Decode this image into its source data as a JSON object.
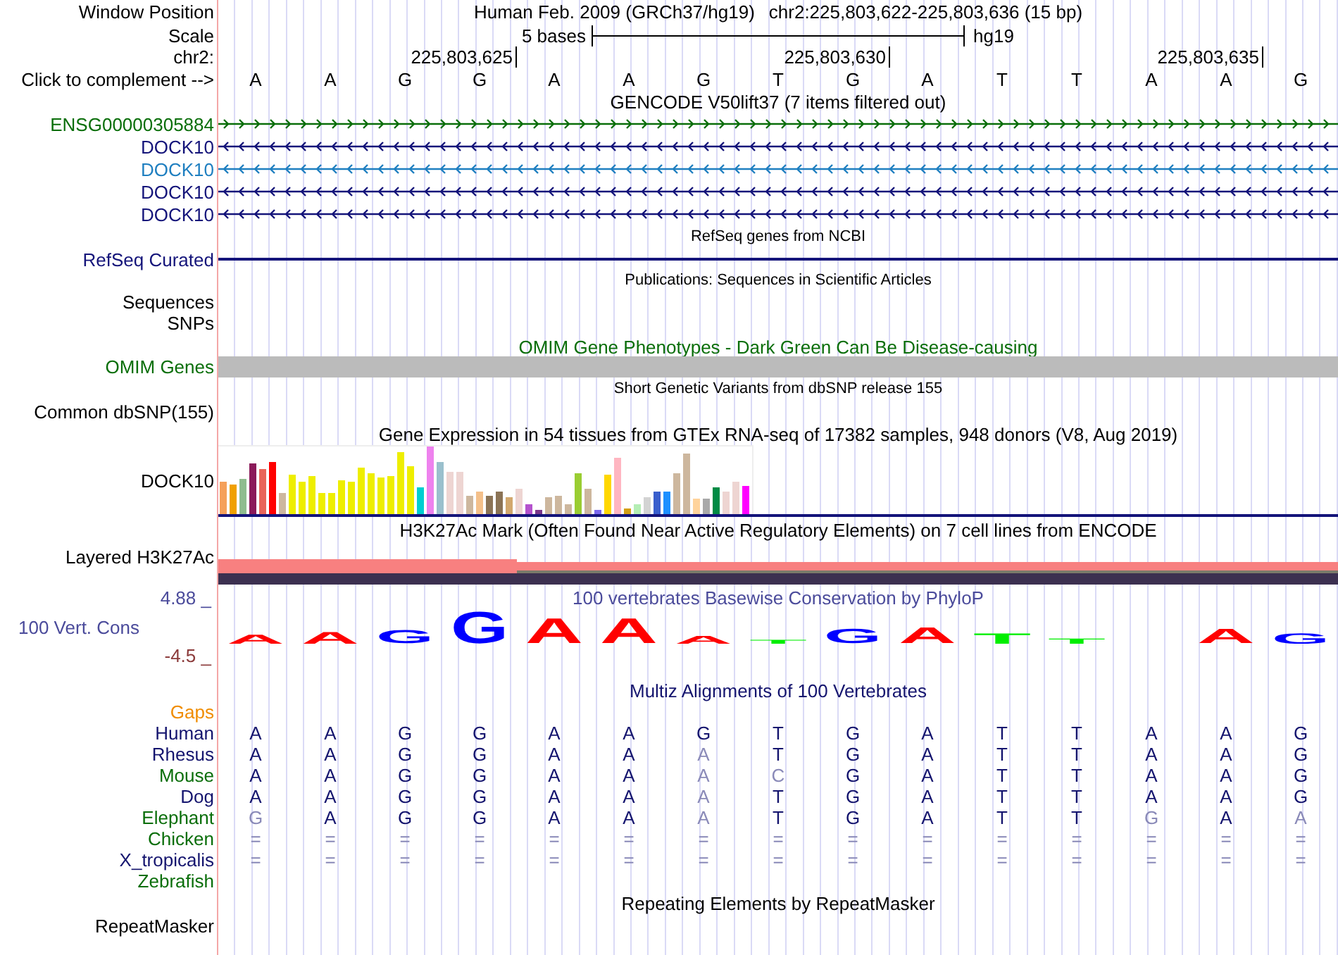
{
  "header": {
    "window_label": "Window Position",
    "assembly": "Human Feb. 2009 (GRCh37/hg19)",
    "position": "chr2:225,803,622-225,803,636 (15 bp)",
    "scale_label": "Scale",
    "scale_text": "5 bases",
    "scale_assembly": "hg19",
    "chrom_label": "chr2:",
    "ticks": [
      "225,803,625",
      "225,803,630",
      "225,803,635"
    ],
    "complement_label": "Click to complement -->",
    "bases": [
      "A",
      "A",
      "G",
      "G",
      "A",
      "A",
      "G",
      "T",
      "G",
      "A",
      "T",
      "T",
      "A",
      "A",
      "G"
    ]
  },
  "gencode": {
    "title": "GENCODE V50lift37 (7 items filtered out)",
    "genes": [
      {
        "name": "ENSG00000305884",
        "color": "#0a6e0a",
        "kind": "forward"
      },
      {
        "name": "DOCK10",
        "color": "#14147a",
        "kind": "reverse"
      },
      {
        "name": "DOCK10",
        "color": "#1f7fc0",
        "kind": "reverse"
      },
      {
        "name": "DOCK10",
        "color": "#14147a",
        "kind": "reverse"
      },
      {
        "name": "DOCK10",
        "color": "#14147a",
        "kind": "reverse"
      }
    ]
  },
  "refseq": {
    "title": "RefSeq genes from NCBI",
    "label": "RefSeq Curated"
  },
  "publications": {
    "title": "Publications: Sequences in Scientific Articles",
    "labels": [
      "Sequences",
      "SNPs"
    ]
  },
  "omim": {
    "title": "OMIM Gene Phenotypes - Dark Green Can Be Disease-causing",
    "label": "OMIM Genes"
  },
  "dbsnp": {
    "title": "Short Genetic Variants from dbSNP release 155",
    "label": "Common dbSNP(155)"
  },
  "gtex": {
    "title": "Gene Expression in 54 tissues from GTEx RNA-seq of 17382 samples, 948 donors (V8, Aug 2019)",
    "label": "DOCK10"
  },
  "h3k27ac": {
    "title": "H3K27Ac Mark (Often Found Near Active Regulatory Elements) on 7 cell lines from ENCODE",
    "label": "Layered H3K27Ac"
  },
  "phylop": {
    "title": "100 vertebrates Basewise Conservation by PhyloP",
    "max": "4.88 _",
    "label": "100 Vert. Cons",
    "min": "-4.5 _",
    "logo": [
      {
        "base": "A"
      },
      {
        "base": "A"
      },
      {
        "base": "G"
      },
      {
        "base": "G"
      },
      {
        "base": "A"
      },
      {
        "base": "A"
      },
      {
        "base": "A"
      },
      {
        "base": "T"
      },
      {
        "base": "G"
      },
      {
        "base": "A"
      },
      {
        "base": "T"
      },
      {
        "base": "T"
      },
      {
        "base": "A"
      },
      {
        "base": "G"
      }
    ]
  },
  "multiz": {
    "title": "Multiz Alignments of 100 Vertebrates",
    "gaps_label": "Gaps",
    "species": [
      {
        "name": "Human",
        "color": "#14146e",
        "bases": [
          "A",
          "A",
          "G",
          "G",
          "A",
          "A",
          "G",
          "T",
          "G",
          "A",
          "T",
          "T",
          "A",
          "A",
          "G"
        ]
      },
      {
        "name": "Rhesus",
        "color": "#14146e",
        "bases": [
          "A",
          "A",
          "G",
          "G",
          "A",
          "A",
          "A",
          "T",
          "G",
          "A",
          "T",
          "T",
          "A",
          "A",
          "G"
        ]
      },
      {
        "name": "Mouse",
        "color": "#0a6e0a",
        "bases": [
          "A",
          "A",
          "G",
          "G",
          "A",
          "A",
          "A",
          "C",
          "G",
          "A",
          "T",
          "T",
          "A",
          "A",
          "G"
        ]
      },
      {
        "name": "Dog",
        "color": "#14146e",
        "bases": [
          "A",
          "A",
          "G",
          "G",
          "A",
          "A",
          "A",
          "T",
          "G",
          "A",
          "T",
          "T",
          "A",
          "A",
          "G"
        ]
      },
      {
        "name": "Elephant",
        "color": "#0a6e0a",
        "bases": [
          "G",
          "A",
          "G",
          "G",
          "A",
          "A",
          "A",
          "T",
          "G",
          "A",
          "T",
          "T",
          "G",
          "A",
          "A"
        ]
      },
      {
        "name": "Chicken",
        "color": "#0a6e0a",
        "bases": [
          "=",
          "=",
          "=",
          "=",
          "=",
          "=",
          "=",
          "=",
          "=",
          "=",
          "=",
          "=",
          "=",
          "=",
          "="
        ]
      },
      {
        "name": "X_tropicalis",
        "color": "#14146e",
        "bases": [
          "=",
          "=",
          "=",
          "=",
          "=",
          "=",
          "=",
          "=",
          "=",
          "=",
          "=",
          "=",
          "=",
          "=",
          "="
        ]
      },
      {
        "name": "Zebrafish",
        "color": "#0a6e0a"
      }
    ]
  },
  "repeatmasker": {
    "title": "Repeating Elements by RepeatMasker",
    "label": "RepeatMasker"
  }
}
